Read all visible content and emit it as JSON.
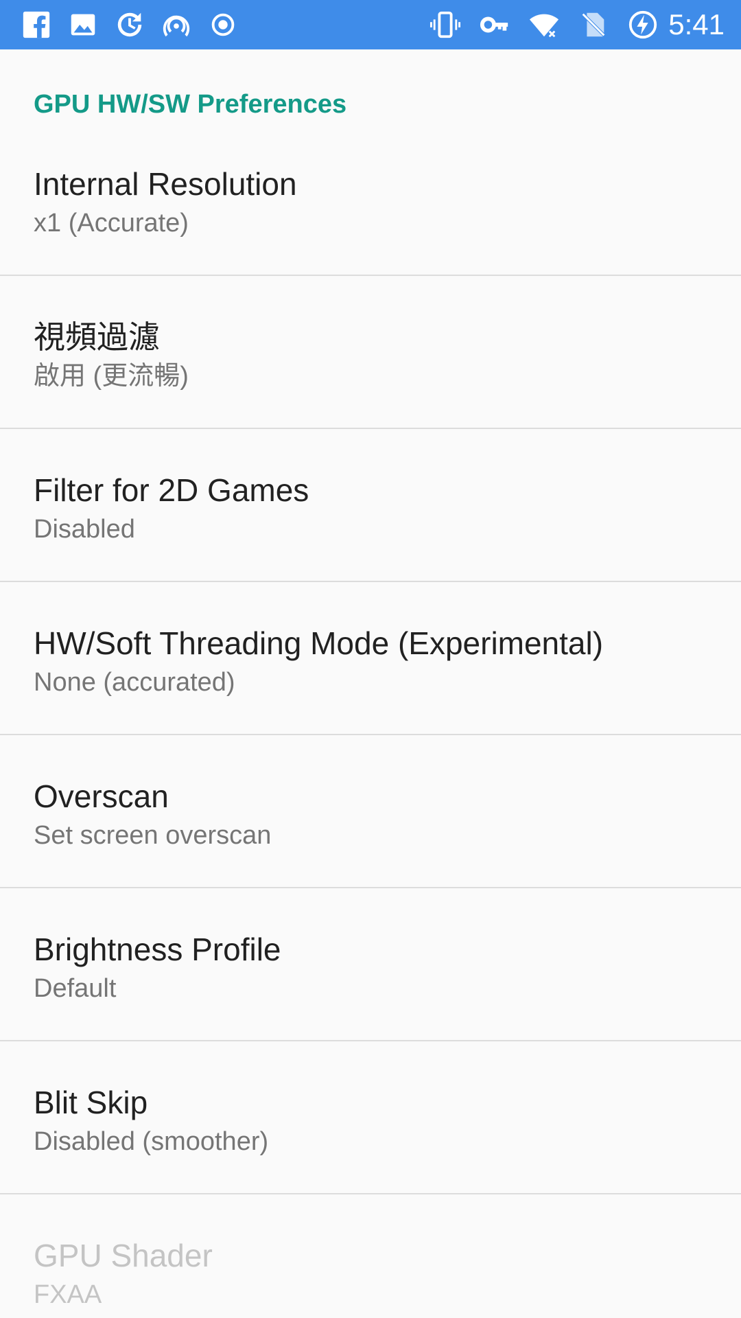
{
  "status_bar": {
    "time": "5:41",
    "left_icons": [
      "facebook-icon",
      "image-icon",
      "sync-clock-icon",
      "hotspot-icon",
      "record-icon"
    ],
    "right_icons": [
      "vibrate-icon",
      "vpn-key-icon",
      "wifi-off-icon",
      "no-sim-icon",
      "battery-charging-icon"
    ],
    "background_color": "#3f8ce9"
  },
  "category": {
    "title": "GPU HW/SW Preferences",
    "color": "#149a88"
  },
  "preferences": [
    {
      "title": "Internal Resolution",
      "summary": "x1 (Accurate)",
      "enabled": true
    },
    {
      "title": "視頻過濾",
      "summary": "啟用 (更流暢)",
      "enabled": true
    },
    {
      "title": "Filter for 2D Games",
      "summary": "Disabled",
      "enabled": true
    },
    {
      "title": "HW/Soft Threading Mode (Experimental)",
      "summary": "None (accurated)",
      "enabled": true
    },
    {
      "title": "Overscan",
      "summary": "Set screen overscan",
      "enabled": true
    },
    {
      "title": "Brightness Profile",
      "summary": "Default",
      "enabled": true
    },
    {
      "title": "Blit Skip",
      "summary": "Disabled (smoother)",
      "enabled": true
    },
    {
      "title": "GPU Shader",
      "summary": "FXAA",
      "enabled": false
    }
  ]
}
